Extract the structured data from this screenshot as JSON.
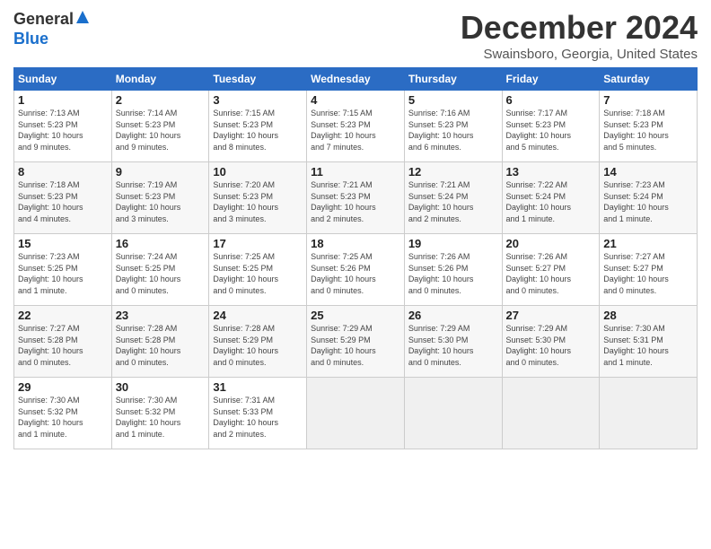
{
  "logo": {
    "general": "General",
    "blue": "Blue"
  },
  "title": "December 2024",
  "location": "Swainsboro, Georgia, United States",
  "days_header": [
    "Sunday",
    "Monday",
    "Tuesday",
    "Wednesday",
    "Thursday",
    "Friday",
    "Saturday"
  ],
  "weeks": [
    [
      {
        "num": "1",
        "info": "Sunrise: 7:13 AM\nSunset: 5:23 PM\nDaylight: 10 hours\nand 9 minutes."
      },
      {
        "num": "2",
        "info": "Sunrise: 7:14 AM\nSunset: 5:23 PM\nDaylight: 10 hours\nand 9 minutes."
      },
      {
        "num": "3",
        "info": "Sunrise: 7:15 AM\nSunset: 5:23 PM\nDaylight: 10 hours\nand 8 minutes."
      },
      {
        "num": "4",
        "info": "Sunrise: 7:15 AM\nSunset: 5:23 PM\nDaylight: 10 hours\nand 7 minutes."
      },
      {
        "num": "5",
        "info": "Sunrise: 7:16 AM\nSunset: 5:23 PM\nDaylight: 10 hours\nand 6 minutes."
      },
      {
        "num": "6",
        "info": "Sunrise: 7:17 AM\nSunset: 5:23 PM\nDaylight: 10 hours\nand 5 minutes."
      },
      {
        "num": "7",
        "info": "Sunrise: 7:18 AM\nSunset: 5:23 PM\nDaylight: 10 hours\nand 5 minutes."
      }
    ],
    [
      {
        "num": "8",
        "info": "Sunrise: 7:18 AM\nSunset: 5:23 PM\nDaylight: 10 hours\nand 4 minutes."
      },
      {
        "num": "9",
        "info": "Sunrise: 7:19 AM\nSunset: 5:23 PM\nDaylight: 10 hours\nand 3 minutes."
      },
      {
        "num": "10",
        "info": "Sunrise: 7:20 AM\nSunset: 5:23 PM\nDaylight: 10 hours\nand 3 minutes."
      },
      {
        "num": "11",
        "info": "Sunrise: 7:21 AM\nSunset: 5:23 PM\nDaylight: 10 hours\nand 2 minutes."
      },
      {
        "num": "12",
        "info": "Sunrise: 7:21 AM\nSunset: 5:24 PM\nDaylight: 10 hours\nand 2 minutes."
      },
      {
        "num": "13",
        "info": "Sunrise: 7:22 AM\nSunset: 5:24 PM\nDaylight: 10 hours\nand 1 minute."
      },
      {
        "num": "14",
        "info": "Sunrise: 7:23 AM\nSunset: 5:24 PM\nDaylight: 10 hours\nand 1 minute."
      }
    ],
    [
      {
        "num": "15",
        "info": "Sunrise: 7:23 AM\nSunset: 5:25 PM\nDaylight: 10 hours\nand 1 minute."
      },
      {
        "num": "16",
        "info": "Sunrise: 7:24 AM\nSunset: 5:25 PM\nDaylight: 10 hours\nand 0 minutes."
      },
      {
        "num": "17",
        "info": "Sunrise: 7:25 AM\nSunset: 5:25 PM\nDaylight: 10 hours\nand 0 minutes."
      },
      {
        "num": "18",
        "info": "Sunrise: 7:25 AM\nSunset: 5:26 PM\nDaylight: 10 hours\nand 0 minutes."
      },
      {
        "num": "19",
        "info": "Sunrise: 7:26 AM\nSunset: 5:26 PM\nDaylight: 10 hours\nand 0 minutes."
      },
      {
        "num": "20",
        "info": "Sunrise: 7:26 AM\nSunset: 5:27 PM\nDaylight: 10 hours\nand 0 minutes."
      },
      {
        "num": "21",
        "info": "Sunrise: 7:27 AM\nSunset: 5:27 PM\nDaylight: 10 hours\nand 0 minutes."
      }
    ],
    [
      {
        "num": "22",
        "info": "Sunrise: 7:27 AM\nSunset: 5:28 PM\nDaylight: 10 hours\nand 0 minutes."
      },
      {
        "num": "23",
        "info": "Sunrise: 7:28 AM\nSunset: 5:28 PM\nDaylight: 10 hours\nand 0 minutes."
      },
      {
        "num": "24",
        "info": "Sunrise: 7:28 AM\nSunset: 5:29 PM\nDaylight: 10 hours\nand 0 minutes."
      },
      {
        "num": "25",
        "info": "Sunrise: 7:29 AM\nSunset: 5:29 PM\nDaylight: 10 hours\nand 0 minutes."
      },
      {
        "num": "26",
        "info": "Sunrise: 7:29 AM\nSunset: 5:30 PM\nDaylight: 10 hours\nand 0 minutes."
      },
      {
        "num": "27",
        "info": "Sunrise: 7:29 AM\nSunset: 5:30 PM\nDaylight: 10 hours\nand 0 minutes."
      },
      {
        "num": "28",
        "info": "Sunrise: 7:30 AM\nSunset: 5:31 PM\nDaylight: 10 hours\nand 1 minute."
      }
    ],
    [
      {
        "num": "29",
        "info": "Sunrise: 7:30 AM\nSunset: 5:32 PM\nDaylight: 10 hours\nand 1 minute."
      },
      {
        "num": "30",
        "info": "Sunrise: 7:30 AM\nSunset: 5:32 PM\nDaylight: 10 hours\nand 1 minute."
      },
      {
        "num": "31",
        "info": "Sunrise: 7:31 AM\nSunset: 5:33 PM\nDaylight: 10 hours\nand 2 minutes."
      },
      {
        "num": "",
        "info": ""
      },
      {
        "num": "",
        "info": ""
      },
      {
        "num": "",
        "info": ""
      },
      {
        "num": "",
        "info": ""
      }
    ]
  ]
}
